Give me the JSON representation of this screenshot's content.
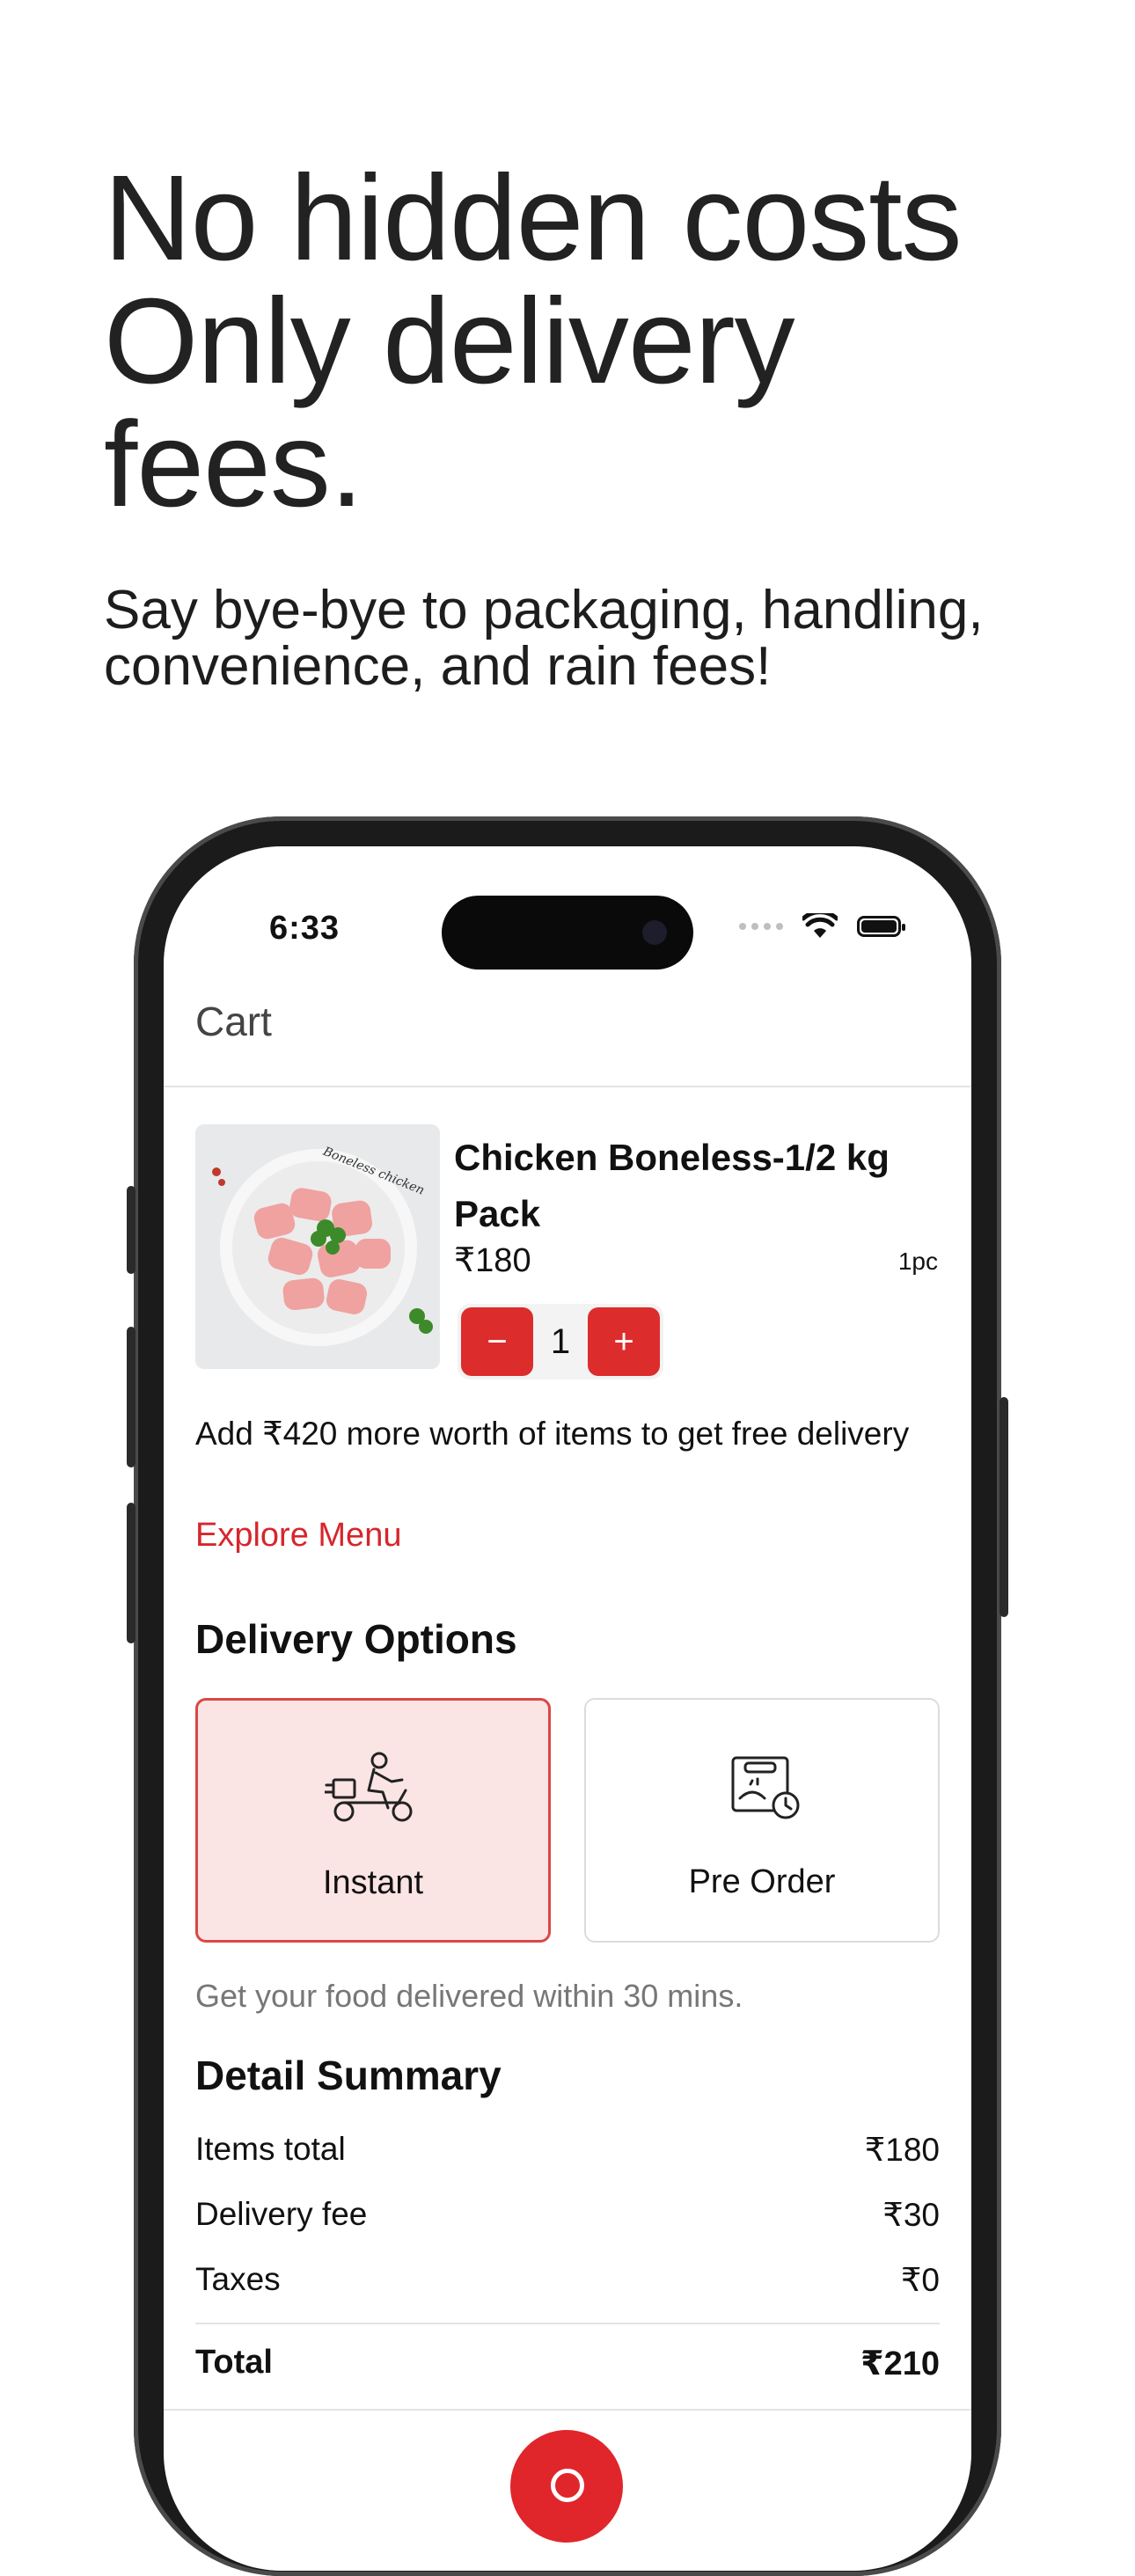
{
  "promo": {
    "headline": [
      "No hidden costs",
      "Only delivery",
      "fees."
    ],
    "subhead": [
      "Say bye-bye to packaging, handling,",
      "convenience, and rain fees!"
    ]
  },
  "status_bar": {
    "time": "6:33"
  },
  "cart": {
    "title": "Cart",
    "item": {
      "image_text": "Boneless chicken",
      "name": "Chicken Boneless-1/2 kg Pack",
      "price": "₹180",
      "unit": "1pc",
      "quantity": "1",
      "minus_label": "−",
      "plus_label": "+"
    },
    "free_delivery_note": "Add ₹420 more worth of items to get free delivery",
    "explore_menu": "Explore Menu"
  },
  "delivery": {
    "title": "Delivery Options",
    "options": [
      {
        "label": "Instant",
        "icon": "scooter-rider-icon",
        "selected": true
      },
      {
        "label": "Pre Order",
        "icon": "scheduled-box-icon",
        "selected": false
      }
    ],
    "note": "Get your food delivered within 30 mins."
  },
  "summary": {
    "title": "Detail Summary",
    "rows": [
      {
        "label": "Items total",
        "value": "₹180"
      },
      {
        "label": "Delivery fee",
        "value": "₹30"
      },
      {
        "label": "Taxes",
        "value": "₹0"
      }
    ],
    "total": {
      "label": "Total",
      "value": "₹210"
    }
  },
  "colors": {
    "accent": "#dd2c2c",
    "selected_bg": "#fbe4e4",
    "muted": "#777777"
  }
}
